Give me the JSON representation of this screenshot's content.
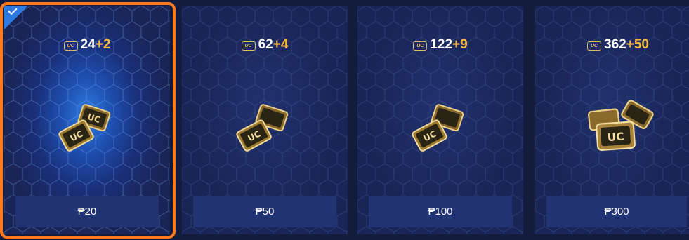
{
  "cards": [
    {
      "badge": "UC",
      "base": "24",
      "bonus": "+2",
      "price": "₱20",
      "selected": true
    },
    {
      "badge": "UC",
      "base": "62",
      "bonus": "+4",
      "price": "₱50",
      "selected": false
    },
    {
      "badge": "UC",
      "base": "122",
      "bonus": "+9",
      "price": "₱100",
      "selected": false
    },
    {
      "badge": "UC",
      "base": "362",
      "bonus": "+50",
      "price": "₱300",
      "selected": false
    }
  ],
  "art": {
    "ticket_label": "UC"
  },
  "colors": {
    "selected_border": "#ff7a1f",
    "card_bg": "#1a2557",
    "price_bg": "#223374",
    "bonus_text": "#f2b93c",
    "check_corner": "#2d79e2"
  },
  "icons": [
    "check-icon",
    "uc-badge-icon",
    "uc-tickets-icon"
  ]
}
